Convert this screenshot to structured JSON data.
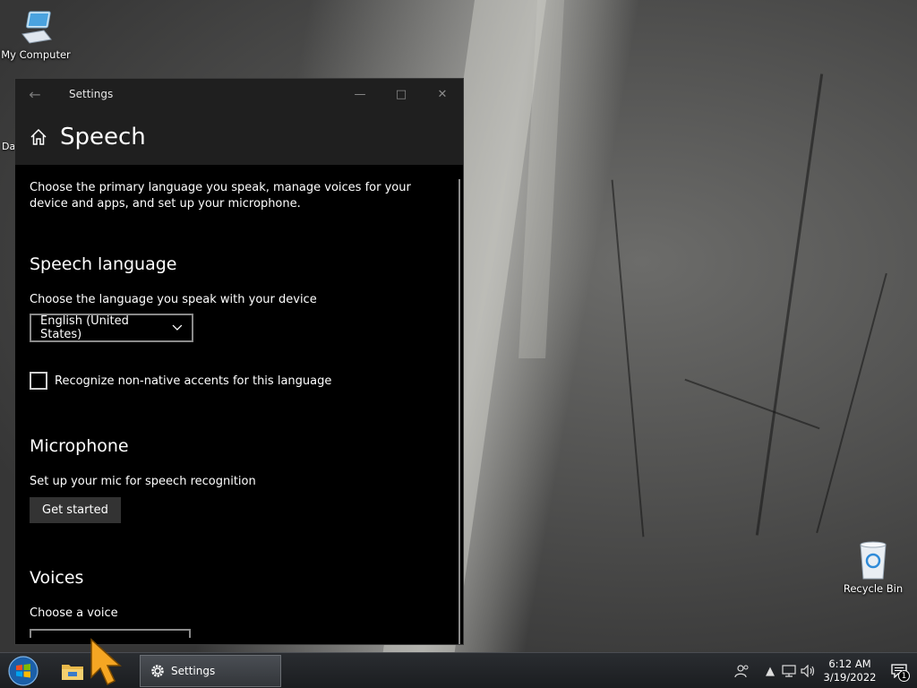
{
  "desktop": {
    "icons": [
      {
        "label": "My Computer",
        "icon": "computer-icon"
      },
      {
        "label": "Recycle Bin",
        "icon": "recycle-bin-icon"
      }
    ],
    "partial_label": "Da"
  },
  "window": {
    "title": "Settings",
    "back_icon": "back-arrow-icon",
    "controls": [
      "minimize-icon",
      "maximize-icon",
      "close-icon"
    ],
    "page_title": "Speech",
    "description": "Choose the primary language you speak, manage voices for your device and apps, and set up your microphone.",
    "speech_language": {
      "heading": "Speech language",
      "label": "Choose the language you speak with your device",
      "dropdown_value": "English (United States)",
      "checkbox_label": "Recognize non-native accents for this language",
      "checkbox_checked": false
    },
    "microphone": {
      "heading": "Microphone",
      "label": "Set up your mic for speech recognition",
      "button": "Get started"
    },
    "voices": {
      "heading": "Voices",
      "label": "Choose a voice"
    }
  },
  "taskbar": {
    "start_icon": "windows-start-icon",
    "pinned": [
      "file-explorer-icon"
    ],
    "task": {
      "label": "Settings",
      "icon": "gear-icon"
    },
    "tray": {
      "icons": [
        "people-icon",
        "chevron-up-icon",
        "network-icon",
        "volume-icon"
      ],
      "time": "6:12 AM",
      "date": "3/19/2022",
      "notification_count": "1"
    }
  }
}
